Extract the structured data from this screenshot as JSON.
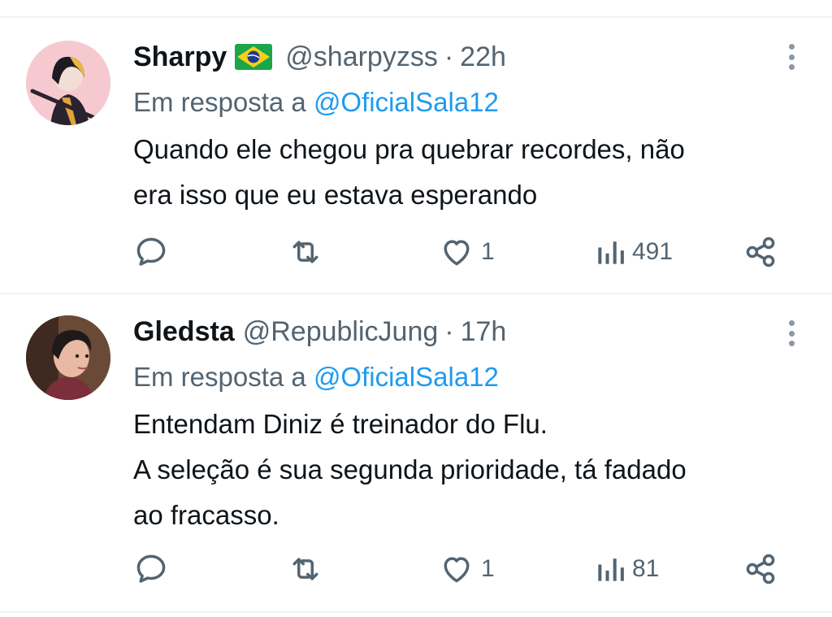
{
  "tweets": [
    {
      "name": "Sharpy",
      "has_flag": true,
      "flag": "brazil-flag",
      "handle": "@sharpyzss",
      "separator": "·",
      "time": "22h",
      "reply_prefix": "Em resposta a",
      "reply_mention": "@OficialSala12",
      "text_lines": [
        "Quando ele chegou pra quebrar recordes, não",
        "era isso que eu estava esperando"
      ],
      "likes": "1",
      "views": "491"
    },
    {
      "name": "Gledsta",
      "has_flag": false,
      "handle": "@RepublicJung",
      "separator": "·",
      "time": "17h",
      "reply_prefix": "Em resposta a",
      "reply_mention": "@OficialSala12",
      "text_lines": [
        "Entendam Diniz é treinador do Flu.",
        "A seleção é sua segunda prioridade, tá fadado",
        "ao fracasso."
      ],
      "likes": "1",
      "views": "81"
    }
  ],
  "icons": [
    "reply-icon",
    "retweet-icon",
    "like-icon",
    "views-icon",
    "share-icon",
    "more-icon"
  ],
  "colors": {
    "text": "#0f1419",
    "secondary": "#536471",
    "link": "#1d9bf0",
    "divider": "#eff3f4"
  }
}
